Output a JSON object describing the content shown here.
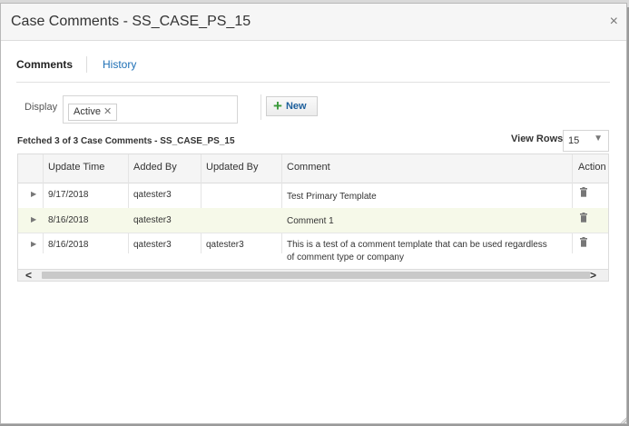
{
  "dialog": {
    "title": "Case Comments - SS_CASE_PS_15",
    "close_glyph": "×"
  },
  "tabs": [
    {
      "label": "Comments",
      "active": true
    },
    {
      "label": "History",
      "active": false
    }
  ],
  "filter": {
    "label": "Display",
    "chip": "Active",
    "chip_remove_glyph": "✕"
  },
  "toolbar": {
    "new_label": "New",
    "plus_glyph": "+"
  },
  "status": {
    "fetched": "Fetched 3 of 3 Case Comments - SS_CASE_PS_15",
    "view_rows_label": "View Rows",
    "view_rows_value": "15"
  },
  "table": {
    "columns": [
      "Update Time",
      "Added By",
      "Updated By",
      "Comment",
      "Action"
    ],
    "rows": [
      {
        "update_time": "9/17/2018",
        "added_by": "qatester3",
        "updated_by": "",
        "comment": "Test Primary Template",
        "selected": false
      },
      {
        "update_time": "8/16/2018",
        "added_by": "qatester3",
        "updated_by": "",
        "comment": "Comment 1",
        "selected": true
      },
      {
        "update_time": "8/16/2018",
        "added_by": "qatester3",
        "updated_by": "qatester3",
        "comment_line1": "This is a test of a comment template that can be used regardless",
        "comment_line2": "of comment type or company",
        "selected": false
      }
    ]
  },
  "colors": {
    "link": "#1d6fb5",
    "selected_row": "#f6f9e9",
    "plus": "#3a9a3a"
  }
}
